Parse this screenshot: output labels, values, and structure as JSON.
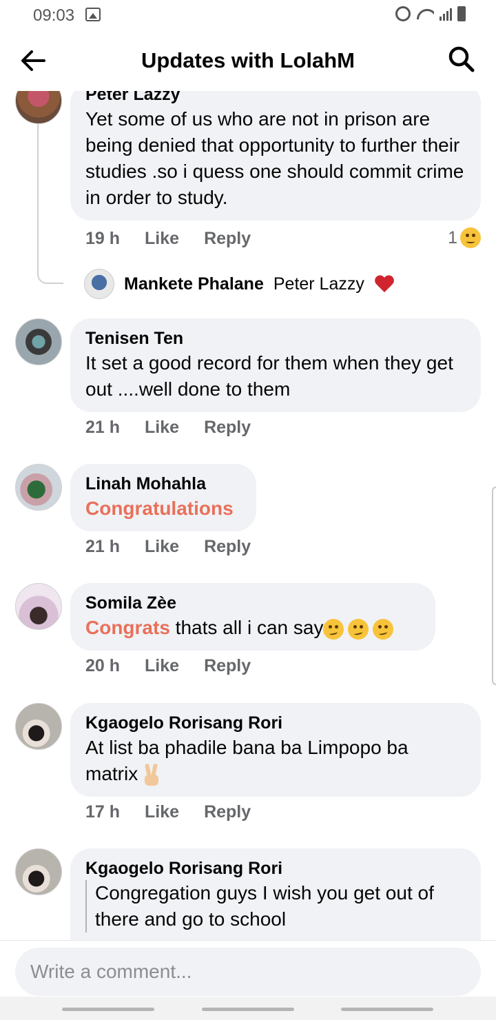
{
  "status_bar": {
    "time": "09:03",
    "icons": [
      "image-icon",
      "alarm-icon",
      "wifi-icon",
      "signal-icon",
      "battery-icon"
    ]
  },
  "header": {
    "title": "Updates with LolahM",
    "back_icon": "arrow-left-icon",
    "search_icon": "search-icon"
  },
  "comments": [
    {
      "author": "Peter Lazzy",
      "text": "Yet some of us who are not in prison are being denied that opportunity to further their studies .so i quess one should commit crime in order to study.",
      "time": "19 h",
      "like": "Like",
      "reply": "Reply",
      "reaction_count": "1",
      "reaction_icon": "sad-face-emoji",
      "replies": [
        {
          "author": "Mankete Phalane",
          "text": "Peter Lazzy",
          "icon": "broken-heart-emoji"
        }
      ]
    },
    {
      "author": "Tenisen Ten",
      "text": "It set a good record for them when they get out ....well done to them",
      "time": "21 h",
      "like": "Like",
      "reply": "Reply"
    },
    {
      "author": "Linah Mohahla",
      "text": "Congratulations",
      "time": "21 h",
      "like": "Like",
      "reply": "Reply"
    },
    {
      "author": "Somila Zèe",
      "highlight": "Congrats",
      "text": " thats all i can say",
      "emoji": "smirk-emoji x3",
      "time": "20 h",
      "like": "Like",
      "reply": "Reply"
    },
    {
      "author": "Kgaogelo Rorisang Rori",
      "text_line1": "At list ba phadile bana ba Limpopo  ba",
      "text_line2": "matrix",
      "emoji": "victory-hand-emoji",
      "time": "17 h",
      "like": "Like",
      "reply": "Reply"
    },
    {
      "author": "Kgaogelo Rorisang Rori",
      "text_line1": "Congregation guys I wish you get out of",
      "text_line2": "there and go to school"
    }
  ],
  "composer": {
    "placeholder": "Write a comment..."
  }
}
